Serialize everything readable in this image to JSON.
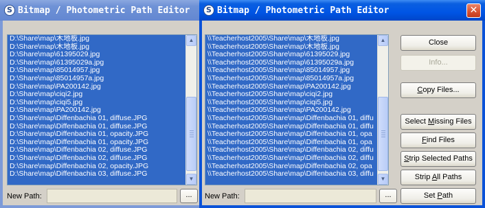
{
  "left_window": {
    "title": "Bitmap / Photometric Path Editor",
    "files": [
      "D:\\Share\\map\\木地板.jpg",
      "D:\\Share\\map\\木地板.jpg",
      "D:\\Share\\map\\61395029.jpg",
      "D:\\Share\\map\\61395029a.jpg",
      "D:\\Share\\map\\85014957.jpg",
      "D:\\Share\\map\\85014957a.jpg",
      "D:\\Share\\map\\PA200142.jpg",
      "D:\\Share\\map\\ciqi2.jpg",
      "D:\\Share\\map\\ciqi5.jpg",
      "D:\\Share\\map\\PA200142.jpg",
      "D:\\Share\\map\\Diffenbachia 01, diffuse.JPG",
      "D:\\Share\\map\\Diffenbachia 01, diffuse.JPG",
      "D:\\Share\\map\\Diffenbachia 01, opacity.JPG",
      "D:\\Share\\map\\Diffenbachia 01, opacity.JPG",
      "D:\\Share\\map\\Diffenbachia 02, diffuse.JPG",
      "D:\\Share\\map\\Diffenbachia 02, diffuse.JPG",
      "D:\\Share\\map\\Diffenbachia 02, opacity.JPG",
      "D:\\Share\\map\\Diffenbachia 03, diffuse.JPG"
    ],
    "new_path_label": "New Path:",
    "new_path_value": "",
    "browse_label": "..."
  },
  "right_window": {
    "title": "Bitmap / Photometric Path Editor",
    "close_glyph": "✕",
    "files": [
      "\\\\Teacherhost2005\\Share\\map\\木地板.jpg",
      "\\\\Teacherhost2005\\Share\\map\\木地板.jpg",
      "\\\\Teacherhost2005\\Share\\map\\61395029.jpg",
      "\\\\Teacherhost2005\\Share\\map\\61395029a.jpg",
      "\\\\Teacherhost2005\\Share\\map\\85014957.jpg",
      "\\\\Teacherhost2005\\Share\\map\\85014957a.jpg",
      "\\\\Teacherhost2005\\Share\\map\\PA200142.jpg",
      "\\\\Teacherhost2005\\Share\\map\\ciqi2.jpg",
      "\\\\Teacherhost2005\\Share\\map\\ciqi5.jpg",
      "\\\\Teacherhost2005\\Share\\map\\PA200142.jpg",
      "\\\\Teacherhost2005\\Share\\map\\Diffenbachia 01, diffu",
      "\\\\Teacherhost2005\\Share\\map\\Diffenbachia 01, diffu",
      "\\\\Teacherhost2005\\Share\\map\\Diffenbachia 01, opa",
      "\\\\Teacherhost2005\\Share\\map\\Diffenbachia 01, opa",
      "\\\\Teacherhost2005\\Share\\map\\Diffenbachia 02, diffu",
      "\\\\Teacherhost2005\\Share\\map\\Diffenbachia 02, diffu",
      "\\\\Teacherhost2005\\Share\\map\\Diffenbachia 02, opa",
      "\\\\Teacherhost2005\\Share\\map\\Diffenbachia 03, diffu"
    ],
    "buttons": {
      "close": "Close",
      "info": "Info...",
      "copy_files": "Copy Files...",
      "select_missing": "Select Missing Files",
      "find_files": "Find Files",
      "strip_selected": "Strip Selected Paths",
      "strip_all": "Strip All Paths",
      "set_path": "Set Path"
    },
    "new_path_label": "New Path:",
    "new_path_value": "",
    "browse_label": "..."
  },
  "colors": {
    "selection": "#3169c6",
    "active_title": "#0055e5",
    "inactive_title": "#7c9ad8",
    "dialog_face": "#d4d0c8"
  }
}
